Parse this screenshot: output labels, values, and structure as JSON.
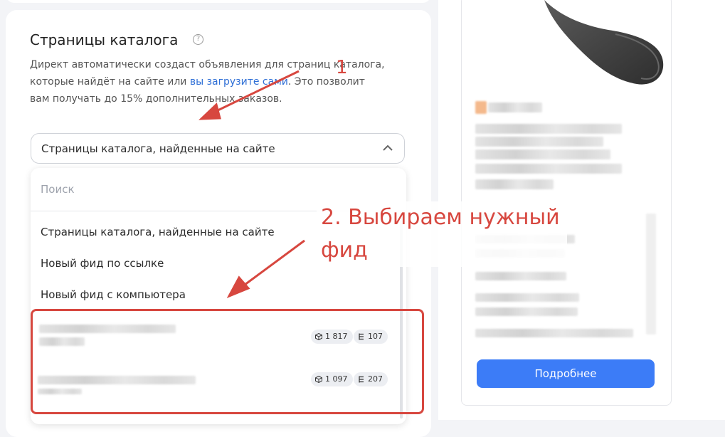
{
  "catalog": {
    "title": "Страницы каталога",
    "help_icon": "question-circle-icon",
    "description_part1": "Директ автоматически создаст объявления для страниц каталога, которые найдёт на сайте или ",
    "description_link": "вы загрузите сами",
    "description_part2": ". Это позволит вам получать до 15% дополнительных заказов."
  },
  "select": {
    "value": "Страницы каталога, найденные на сайте",
    "chevron_icon": "chevron-up-icon"
  },
  "dropdown": {
    "search_placeholder": "Поиск",
    "options": [
      "Страницы каталога, найденные на сайте",
      "Новый фид по ссылке",
      "Новый фид с компьютера"
    ],
    "feeds": [
      {
        "products": "1 817",
        "categories": "107"
      },
      {
        "products": "1 097",
        "categories": "207"
      }
    ]
  },
  "annotations": {
    "step1": "1",
    "step2": "2. Выбираем нужный фид"
  },
  "preview": {
    "button_label": "Подробнее"
  },
  "colors": {
    "accent_link": "#2f6fd6",
    "annotation_red": "#d7473f",
    "button_blue": "#3c7cf7"
  }
}
